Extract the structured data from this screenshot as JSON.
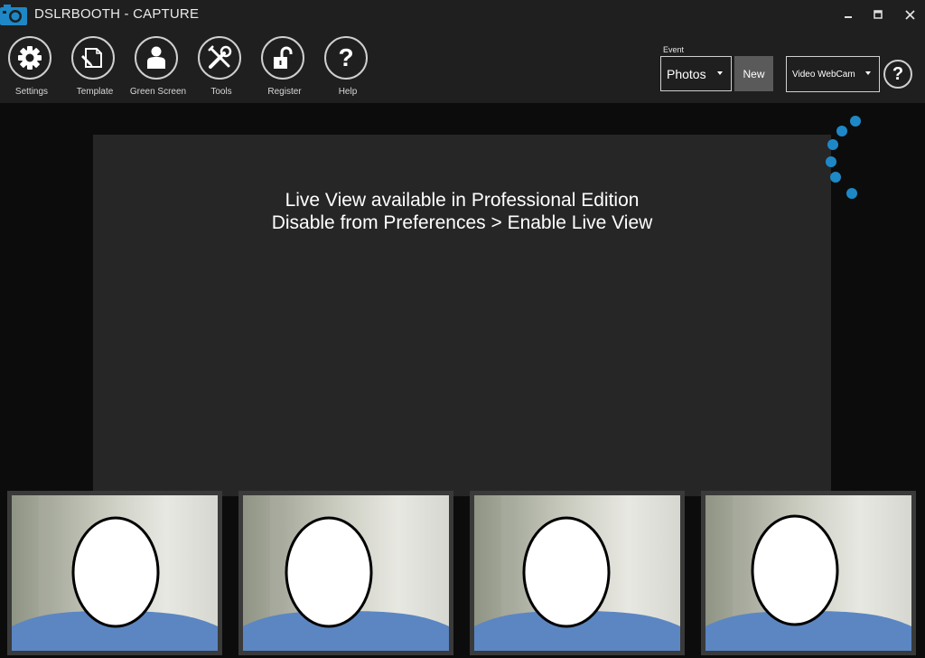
{
  "window": {
    "title": "DSLRBOOTH - CAPTURE",
    "icons": {
      "logo": "camera-logo-icon",
      "minimize": "minimize-icon",
      "maximize": "maximize-icon",
      "close": "close-icon"
    }
  },
  "toolbar": {
    "items": [
      {
        "label": "Settings",
        "icon": "gear-icon"
      },
      {
        "label": "Template",
        "icon": "template-edit-icon"
      },
      {
        "label": "Green Screen",
        "icon": "person-icon"
      },
      {
        "label": "Tools",
        "icon": "tools-icon"
      },
      {
        "label": "Register",
        "icon": "unlock-icon"
      },
      {
        "label": "Help",
        "icon": "question-icon"
      }
    ]
  },
  "event": {
    "label": "Event",
    "selected": "Photos",
    "new_label": "New"
  },
  "camera": {
    "selected": "Video WebCam",
    "help_glyph": "?"
  },
  "live_view": {
    "line1": "Live View available in Professional Edition",
    "line2": "Disable from Preferences > Enable Live View"
  },
  "thumbnails": {
    "count": 4,
    "content": "webcam-photo-with-blurred-face"
  },
  "colors": {
    "toolbar_bg": "#1f1f1f",
    "app_bg": "#0c0c0c",
    "live_view_bg": "#262626",
    "accent_blue": "#1e88c7",
    "new_button_bg": "#5a5a5a"
  }
}
